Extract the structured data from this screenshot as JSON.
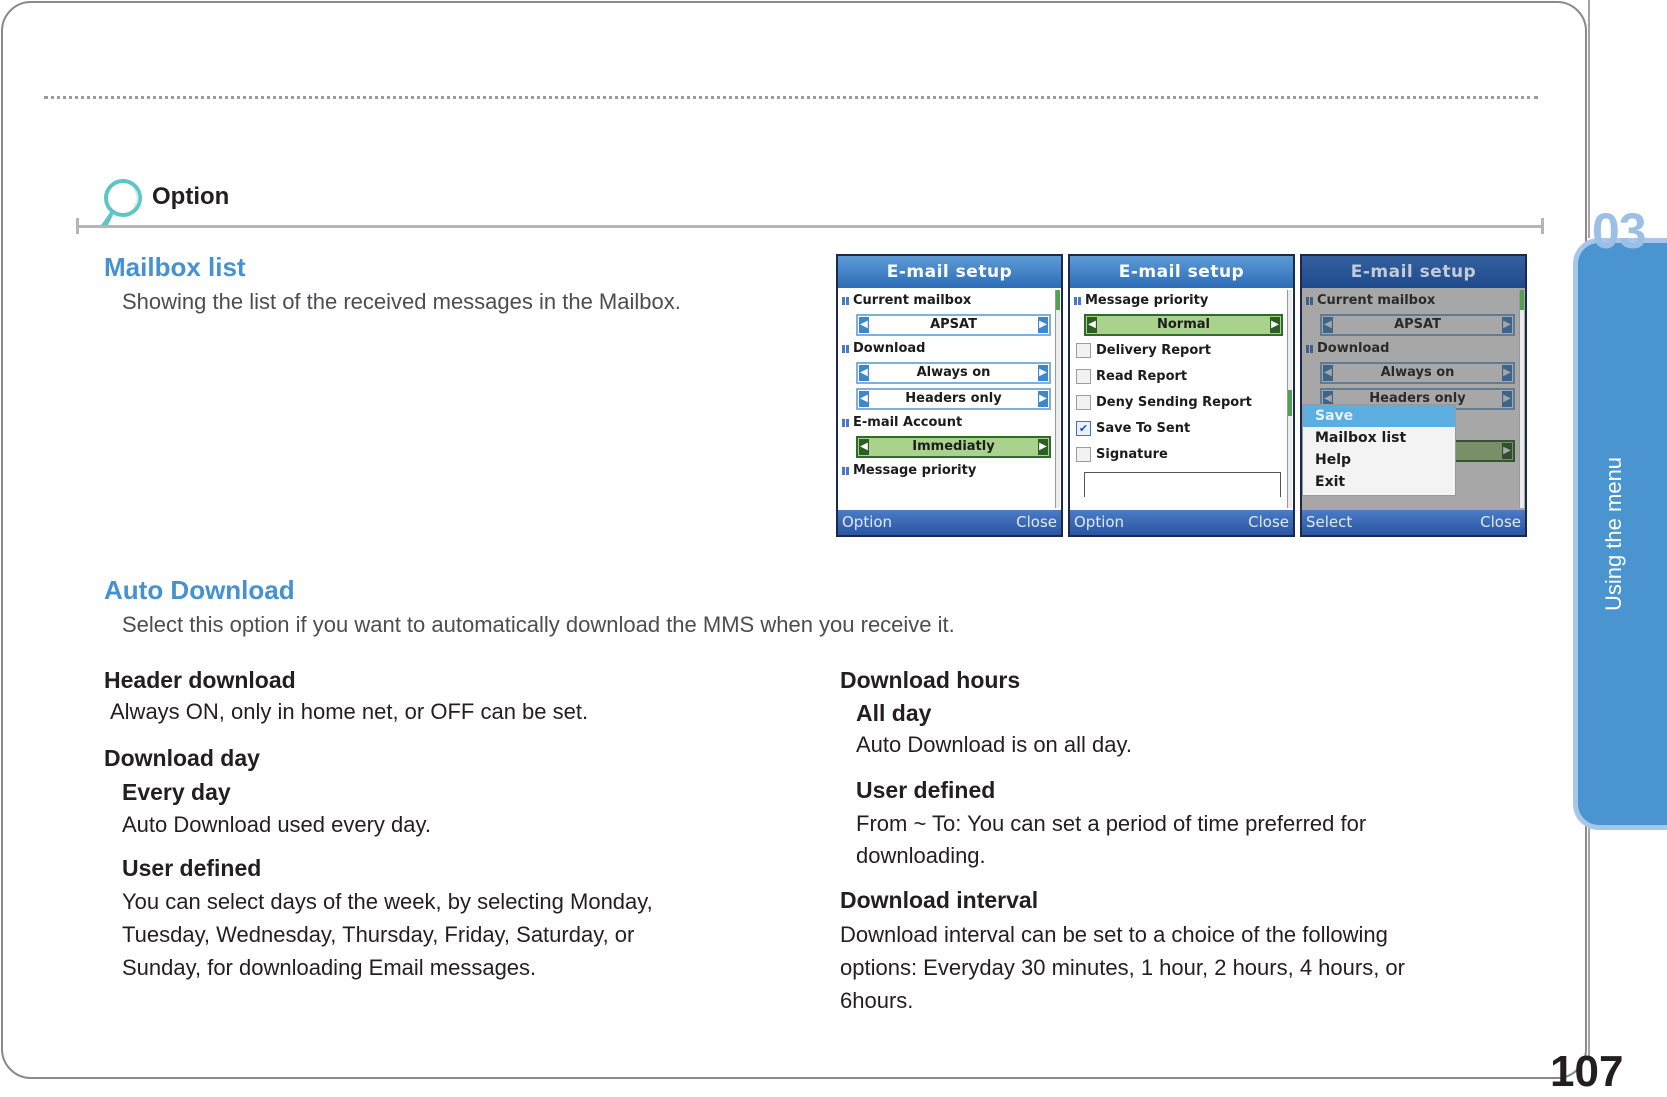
{
  "section": {
    "title": "Option"
  },
  "chapter": {
    "number": "03",
    "label": "Using the menu"
  },
  "page_number": "107",
  "mailbox_list": {
    "heading": "Mailbox list",
    "description": "Showing the list of the received messages in the Mailbox."
  },
  "auto_download": {
    "heading": "Auto Download",
    "description": "Select this option if you want to automatically download the MMS when you receive it."
  },
  "left_column": {
    "header_download": {
      "heading": "Header download",
      "text": "Always ON, only in home net, or OFF can be set."
    },
    "download_day": {
      "heading": "Download day",
      "every_day": {
        "heading": "Every day",
        "text": "Auto Download used every day."
      },
      "user_defined": {
        "heading": "User defined",
        "lines": [
          "You can select days of the week, by selecting Monday,",
          "Tuesday, Wednesday, Thursday, Friday, Saturday, or",
          "Sunday, for downloading Email messages."
        ]
      }
    }
  },
  "right_column": {
    "download_hours": {
      "heading": "Download hours",
      "all_day": {
        "heading": "All day",
        "text": "Auto Download is on all day."
      },
      "user_defined": {
        "heading": "User defined",
        "lines": [
          "From ~ To: You can set a period of time preferred for",
          "downloading."
        ]
      }
    },
    "download_interval": {
      "heading": "Download interval",
      "lines": [
        "Download interval can be set to a choice of the following",
        "options: Everyday 30 minutes, 1 hour, 2 hours, 4 hours, or",
        "6hours."
      ]
    }
  },
  "screens": [
    {
      "title": "E-mail setup",
      "labels": [
        "Current mailbox",
        "Download",
        "E-mail Account",
        "Message priority"
      ],
      "selects": [
        "APSAT",
        "Always on",
        "Headers only",
        "Immediatly"
      ],
      "softkey_left": "Option",
      "softkey_right": "Close"
    },
    {
      "title": "E-mail setup",
      "label": "Message priority",
      "select": "Normal",
      "checkboxes": [
        {
          "label": "Delivery Report",
          "checked": false
        },
        {
          "label": "Read Report",
          "checked": false
        },
        {
          "label": "Deny Sending Report",
          "checked": false
        },
        {
          "label": "Save To Sent",
          "checked": true
        },
        {
          "label": "Signature",
          "checked": false
        }
      ],
      "softkey_left": "Option",
      "softkey_right": "Close"
    },
    {
      "title": "E-mail setup",
      "labels": [
        "Current mailbox",
        "Download"
      ],
      "selects": [
        "APSAT",
        "Always on",
        "Headers only"
      ],
      "menu": [
        "Save",
        "Mailbox list",
        "Help",
        "Exit"
      ],
      "menu_highlighted": "Save",
      "softkey_left": "Select",
      "softkey_right": "Close"
    }
  ],
  "colors": {
    "heading_blue": "#4592d2",
    "chapter_tab": "#4a94d0",
    "chapter_number": "#9cbfe6",
    "active_select": "#a9d38d"
  }
}
